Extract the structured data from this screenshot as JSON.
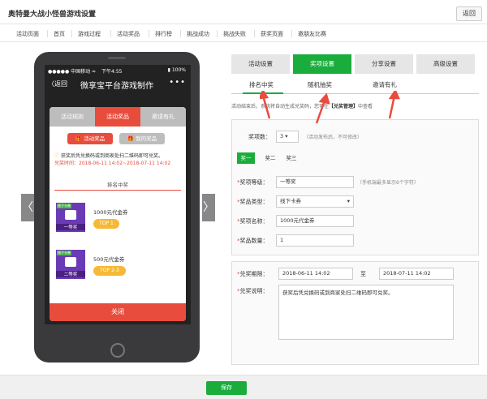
{
  "header": {
    "title": "奥特曼大战小怪兽游戏设置",
    "back_label": "返回"
  },
  "nav": [
    "活动页面",
    "首页",
    "游戏过程",
    "活动奖品",
    "排行榜",
    "挑战成功",
    "挑战失败",
    "获奖页面",
    "邀朋友比赛"
  ],
  "phone": {
    "status_left": "●●●●● 中国移动 ≈",
    "status_time": "下午4:55",
    "status_right": "▮ 100%",
    "nav_back": "〈返回",
    "nav_title": "微享宝平台游戏制作",
    "nav_more": "•••",
    "modal_tabs": [
      "活动规则",
      "活动奖品",
      "邀请有礼"
    ],
    "pill_active": "活动奖品",
    "pill_inactive": "我的奖品",
    "notice": "获奖后凭兑换码或到商家处扫二维码即可兑奖。",
    "notice_time": "兑奖时间：2018-06-11 14:02~2018-07-11 14:02",
    "rank_title": "排名中奖",
    "prizes": [
      {
        "tag": "线下卡券",
        "label": "一等奖",
        "name": "1000元代金券",
        "top": "TOP 1"
      },
      {
        "tag": "线下卡券",
        "label": "二等奖",
        "name": "500元代金券",
        "top": "TOP 2-3"
      }
    ],
    "close_label": "关闭"
  },
  "side_arrows": {
    "left": "〈",
    "right": "〉"
  },
  "tabs": [
    "活动设置",
    "奖项设置",
    "分享设置",
    "高级设置"
  ],
  "subtabs": [
    "排名中奖",
    "随机抽奖",
    "邀请有礼"
  ],
  "desc": {
    "prefix": "活动结束后，系统将自动生成兑奖码，您可在",
    "link": "【兑奖管理】",
    "suffix": "中查看"
  },
  "form": {
    "count_label": "奖项数：",
    "count_value": "3 ▾",
    "count_hint": "（活动发布后，不可修改）",
    "prize_tabs": [
      "奖一",
      "奖二",
      "奖三"
    ],
    "level_label": "奖项等级：",
    "level_value": "一等奖",
    "level_hint": "（手机端最多显示6个字符）",
    "type_label": "奖品类型：",
    "type_value": "线下卡券",
    "name_label": "奖项名称：",
    "name_value": "1000元代金券",
    "qty_label": "奖品数量：",
    "qty_value": "1"
  },
  "redeem": {
    "period_label": "兑奖期限：",
    "start": "2018-06-11 14:02",
    "to": "至",
    "end": "2018-07-11 14:02",
    "desc_label": "兑奖说明：",
    "desc_value": "获奖后凭兑换码或到商家处扫二维码即可兑奖。"
  },
  "footer": {
    "save_label": "保存"
  },
  "colors": {
    "green": "#1aad3c",
    "red": "#e84c3d",
    "phone": "#3a3a3c"
  }
}
